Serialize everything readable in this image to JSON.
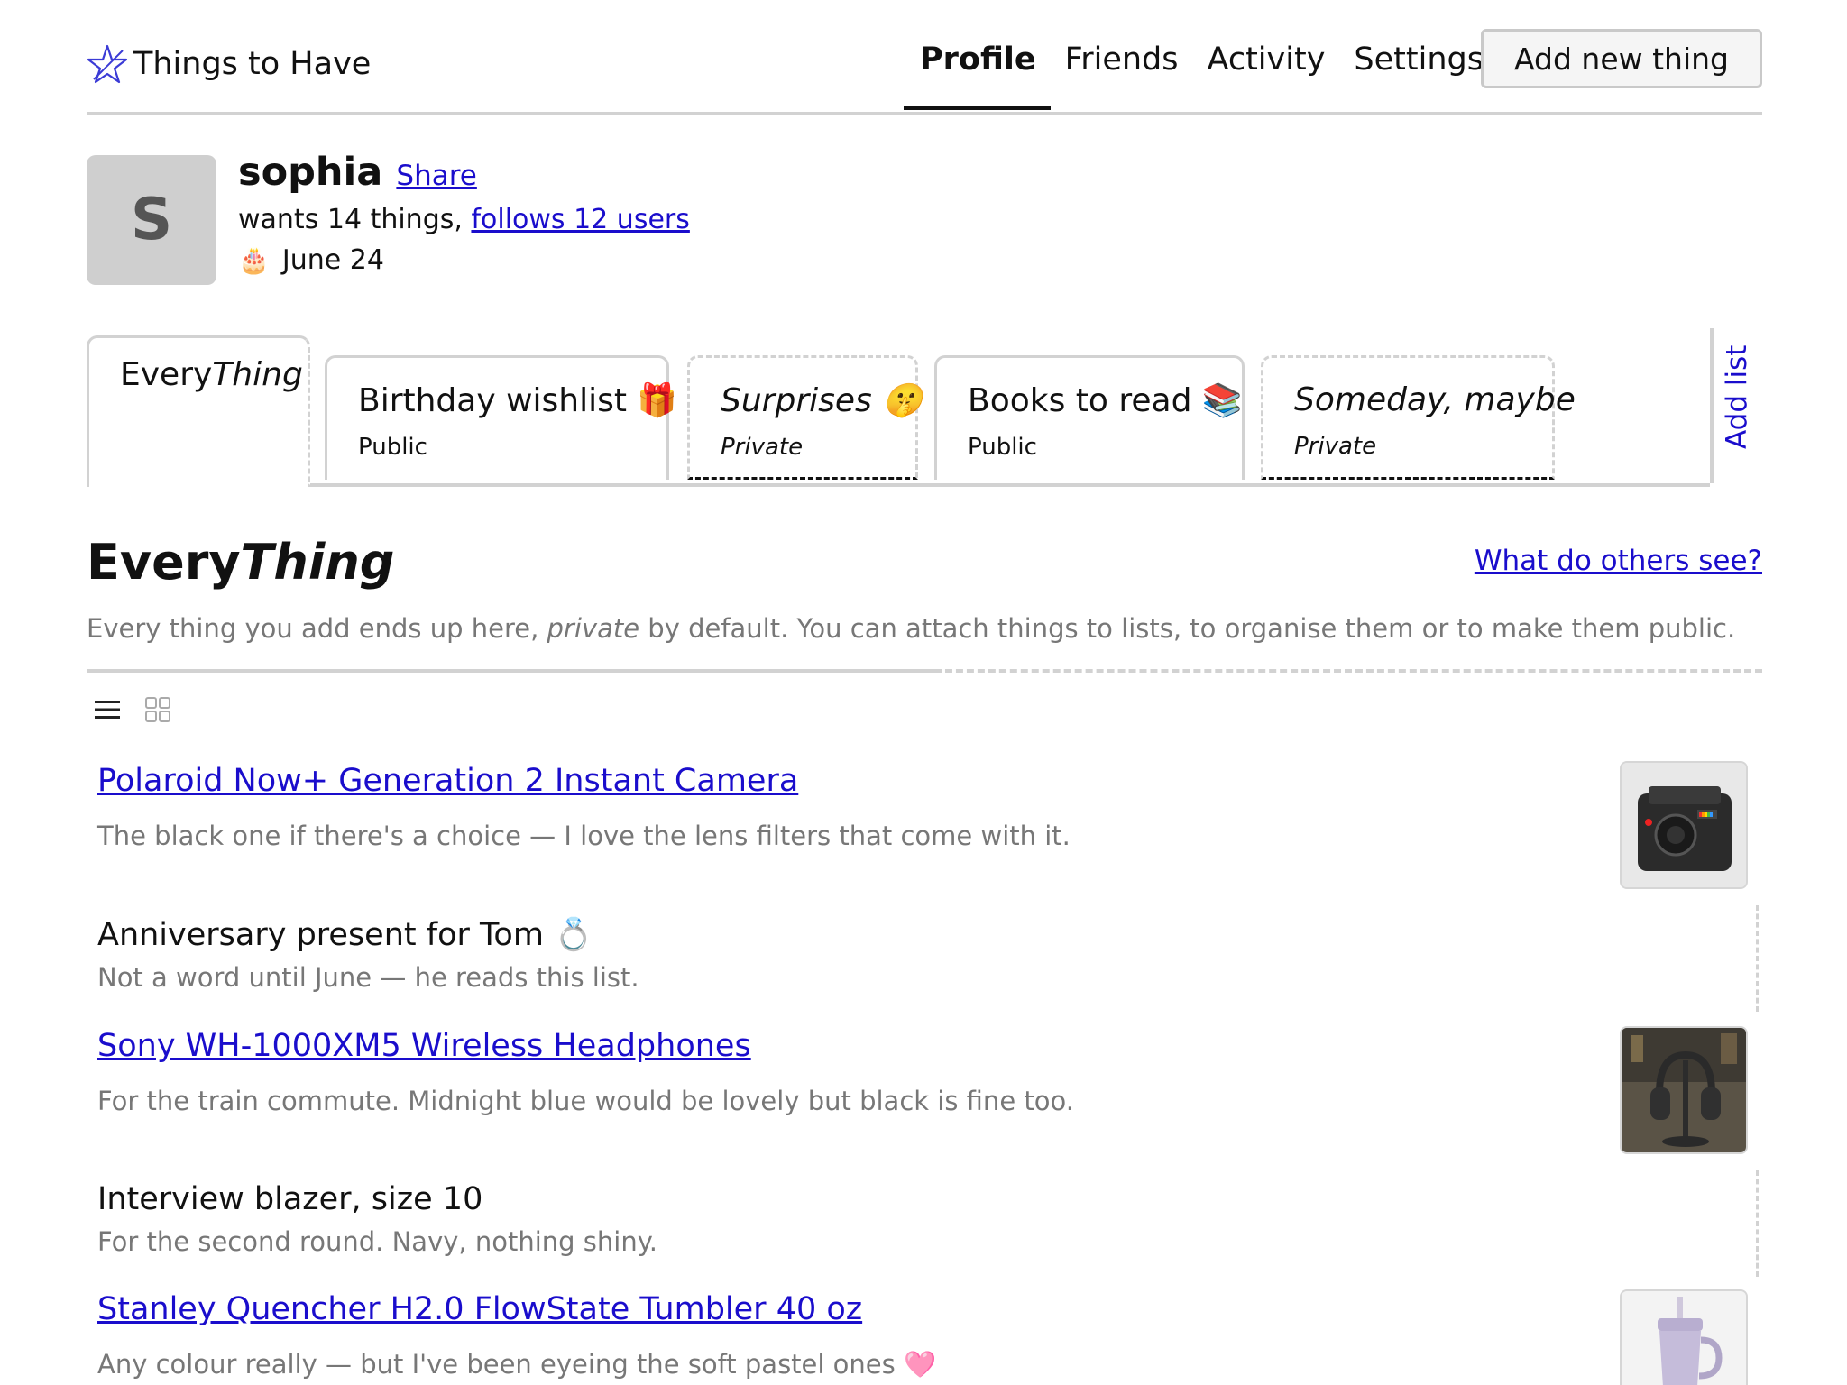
{
  "header": {
    "logo_text": "Things to Have",
    "nav": [
      {
        "label": "Profile",
        "active": true
      },
      {
        "label": "Friends",
        "active": false
      },
      {
        "label": "Activity",
        "active": false
      },
      {
        "label": "Settings",
        "active": false
      }
    ],
    "add_button": "Add new thing"
  },
  "profile": {
    "avatar_letter": "S",
    "name": "sophia",
    "share": "Share",
    "wants_text": "wants 14 things,",
    "follows_link": "follows 12 users",
    "birthday_icon": "🎂",
    "birthday": "June 24"
  },
  "tabs": [
    {
      "title_a": "Every",
      "title_b": "Thing",
      "sub": ""
    },
    {
      "title": "Birthday wishlist 🎁",
      "sub": "Public"
    },
    {
      "title": "Surprises 🤫",
      "sub": "Private"
    },
    {
      "title": "Books to read 📚",
      "sub": "Public"
    },
    {
      "title": "Someday, maybe",
      "sub": "Private"
    }
  ],
  "add_list": "Add list",
  "section": {
    "title_a": "Every",
    "title_b": "Thing",
    "others_link": "What do others see?",
    "desc_a": "Every thing you add ends up here, ",
    "desc_em": "private",
    "desc_b": " by default. You can attach things to lists, to organise them or to make them public."
  },
  "items": [
    {
      "title": "Polaroid Now+ Generation 2 Instant Camera",
      "note": "The black one if there's a choice — I love the lens filters that come with it.",
      "is_link": true,
      "thumb": "camera"
    },
    {
      "title": "Anniversary present for Tom 💍",
      "note": "Not a word until June — he reads this list.",
      "is_link": false,
      "thumb": ""
    },
    {
      "title": "Sony WH-1000XM5 Wireless Headphones",
      "note": "For the train commute. Midnight blue would be lovely but black is fine too.",
      "is_link": true,
      "thumb": "headphones"
    },
    {
      "title": "Interview blazer, size 10",
      "note": "For the second round. Navy, nothing shiny.",
      "is_link": false,
      "thumb": ""
    },
    {
      "title": "Stanley Quencher H2.0 FlowState Tumbler 40 oz",
      "note": "Any colour really — but I've been eyeing the soft pastel ones 🩷",
      "is_link": true,
      "thumb": "tumbler"
    }
  ],
  "colors": {
    "link": "#1a0dcc",
    "muted": "#777777",
    "border": "#d2d2d2",
    "logo_star": "#3b3bd6"
  }
}
